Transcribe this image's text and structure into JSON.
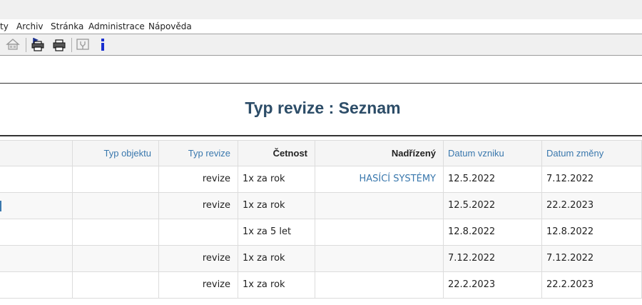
{
  "menu": {
    "items": [
      "ty",
      "Archiv",
      "Stránka",
      "Administrace",
      "Nápověda"
    ]
  },
  "toolbar": {
    "icons": [
      "home-icon",
      "print-flag-icon",
      "print-icon",
      "plugin-icon",
      "info-icon"
    ],
    "info_glyph": "i"
  },
  "page": {
    "title": "Typ revize : Seznam"
  },
  "table": {
    "headers": {
      "typ_objektu": "Typ objektu",
      "typ_revize": "Typ revize",
      "cetnost": "Četnost",
      "nadrizeny": "Nadřízený",
      "datum_vzniku": "Datum vzniku",
      "datum_zmeny": "Datum změny"
    },
    "rows": [
      {
        "typ_objektu": "",
        "typ_revize": "revize",
        "cetnost": "1x za rok",
        "nadrizeny": "HASÍCÍ SYSTÉMY",
        "datum_vzniku": "12.5.2022",
        "datum_zmeny": "7.12.2022"
      },
      {
        "typ_objektu": "",
        "typ_revize": "revize",
        "cetnost": "1x za rok",
        "nadrizeny": "",
        "datum_vzniku": "12.5.2022",
        "datum_zmeny": "22.2.2023"
      },
      {
        "typ_objektu": "",
        "typ_revize": "",
        "cetnost": "1x za 5 let",
        "nadrizeny": "",
        "datum_vzniku": "12.8.2022",
        "datum_zmeny": "12.8.2022"
      },
      {
        "typ_objektu": "",
        "typ_revize": "revize",
        "cetnost": "1x za rok",
        "nadrizeny": "",
        "datum_vzniku": "7.12.2022",
        "datum_zmeny": "7.12.2022"
      },
      {
        "typ_objektu": "",
        "typ_revize": "revize",
        "cetnost": "1x za rok",
        "nadrizeny": "",
        "datum_vzniku": "22.2.2023",
        "datum_zmeny": "22.2.2023"
      }
    ]
  },
  "colors": {
    "title": "#2d4d68",
    "link": "#3a78ad",
    "header_bg": "#f5f5f5"
  }
}
